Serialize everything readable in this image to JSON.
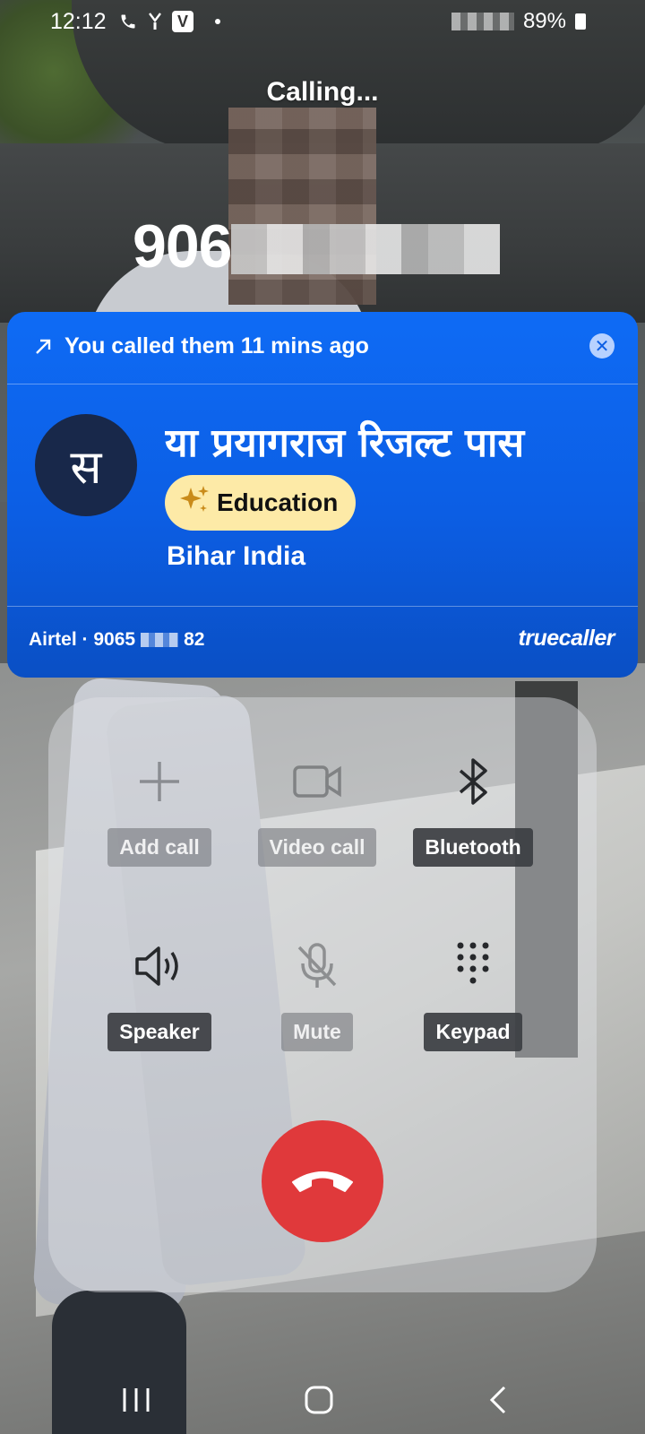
{
  "status_bar": {
    "time": "12:12",
    "battery": "89%"
  },
  "call": {
    "status": "Calling...",
    "number_visible": "906"
  },
  "truecaller": {
    "last_call": "You called them 11 mins ago",
    "avatar_initial": "स",
    "name": "या प्रयागराज रिजल्ट पास",
    "tag": "Education",
    "location": "Bihar India",
    "carrier": "Airtel · 9065",
    "carrier_suffix": "82",
    "brand": "truecaller",
    "colors": {
      "card": "#0c5ee4",
      "tag_bg": "#fdeaa7"
    }
  },
  "controls": {
    "add_call": "Add call",
    "video_call": "Video call",
    "bluetooth": "Bluetooth",
    "speaker": "Speaker",
    "mute": "Mute",
    "keypad": "Keypad"
  },
  "end_call": {
    "color": "#e0393b",
    "icon": "end-call-icon"
  },
  "nav": {
    "recents_icon": "recents-icon",
    "home_icon": "home-icon",
    "back_icon": "back-icon"
  }
}
